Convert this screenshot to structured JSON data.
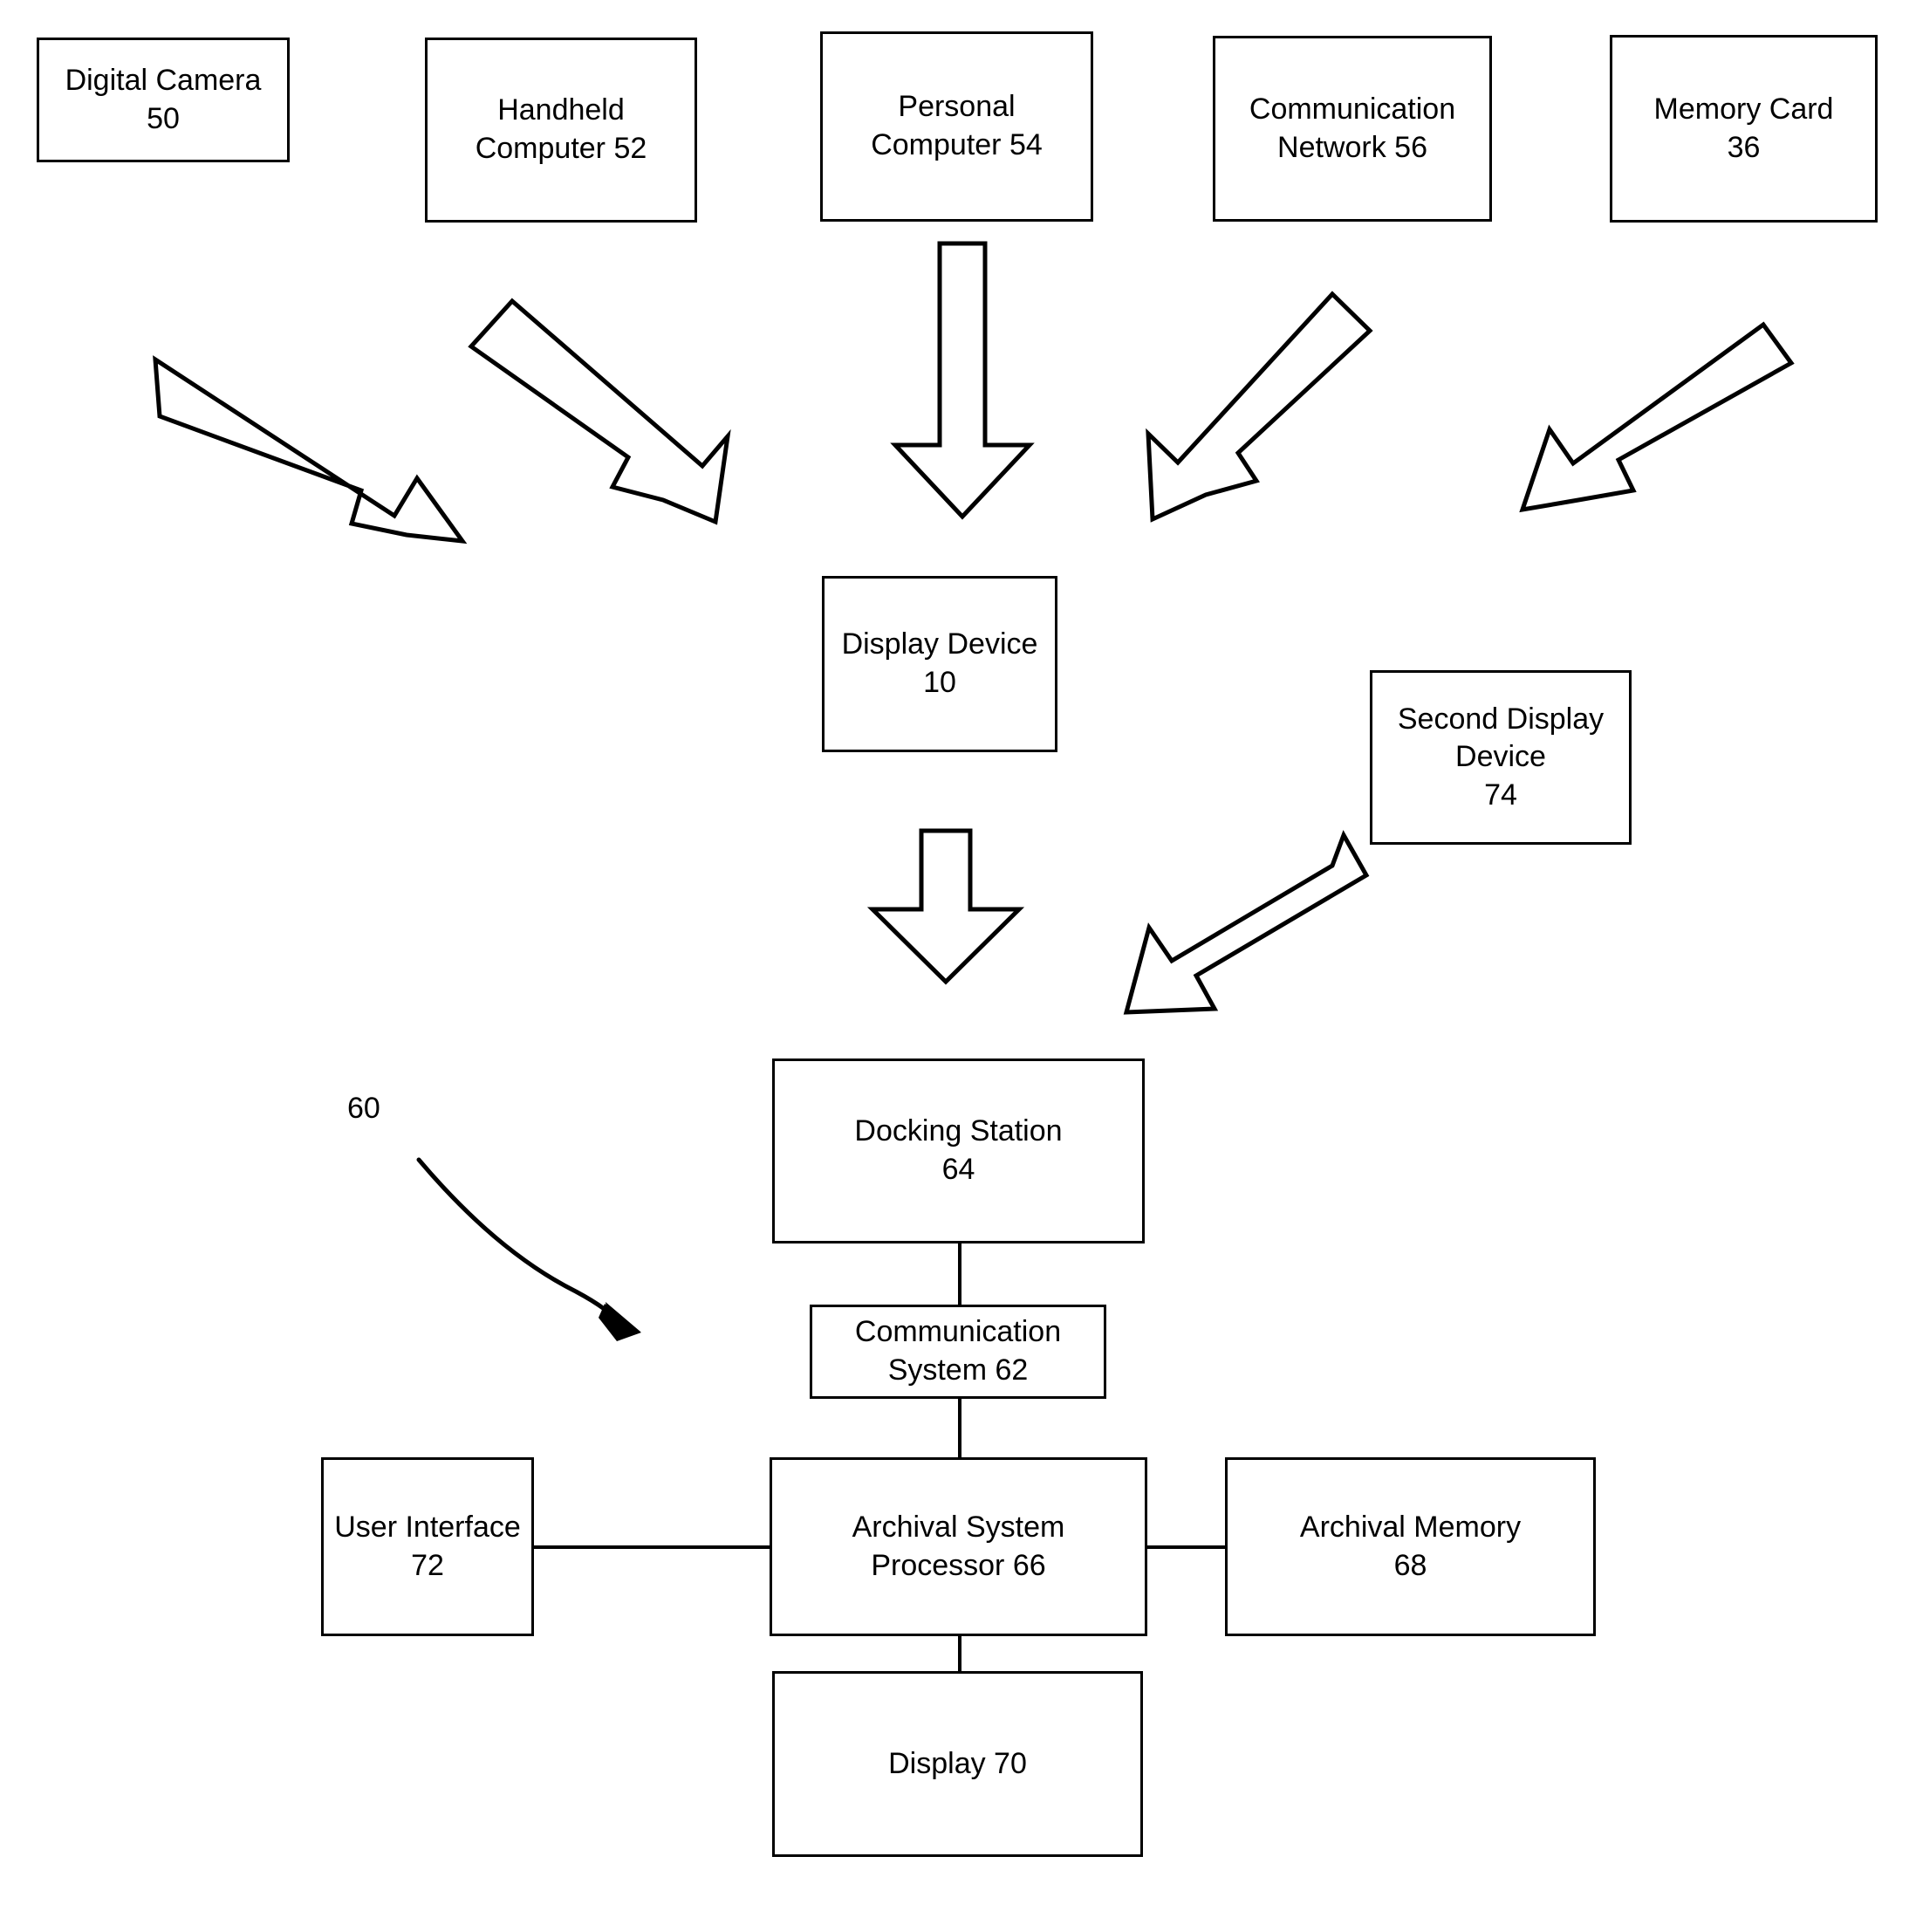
{
  "figure": {
    "type": "patent-block-diagram",
    "system_reference_label": "60",
    "nodes": [
      {
        "id": "digital-camera",
        "label": "Digital Camera\n50",
        "name": "Digital Camera",
        "ref": "50"
      },
      {
        "id": "handheld-computer",
        "label": "Handheld\nComputer 52",
        "name": "Handheld Computer",
        "ref": "52"
      },
      {
        "id": "personal-computer",
        "label": "Personal\nComputer 54",
        "name": "Personal Computer",
        "ref": "54"
      },
      {
        "id": "communication-network",
        "label": "Communication\nNetwork 56",
        "name": "Communication Network",
        "ref": "56"
      },
      {
        "id": "memory-card",
        "label": "Memory Card\n36",
        "name": "Memory Card",
        "ref": "36"
      },
      {
        "id": "display-device",
        "label": "Display Device\n10",
        "name": "Display Device",
        "ref": "10"
      },
      {
        "id": "second-display-device",
        "label": "Second Display\nDevice\n74",
        "name": "Second Display Device",
        "ref": "74"
      },
      {
        "id": "docking-station",
        "label": "Docking Station\n64",
        "name": "Docking Station",
        "ref": "64"
      },
      {
        "id": "communication-system",
        "label": "Communication\nSystem 62",
        "name": "Communication System",
        "ref": "62"
      },
      {
        "id": "user-interface",
        "label": "User Interface\n72",
        "name": "User Interface",
        "ref": "72"
      },
      {
        "id": "archival-system-processor",
        "label": "Archival System\nProcessor 66",
        "name": "Archival System Processor",
        "ref": "66"
      },
      {
        "id": "archival-memory",
        "label": "Archival Memory\n68",
        "name": "Archival Memory",
        "ref": "68"
      },
      {
        "id": "display-70",
        "label": "Display 70",
        "name": "Display",
        "ref": "70"
      }
    ],
    "connections": [
      {
        "from": "digital-camera",
        "to": "display-device",
        "style": "block-arrow-diagonal"
      },
      {
        "from": "handheld-computer",
        "to": "display-device",
        "style": "block-arrow-diagonal"
      },
      {
        "from": "personal-computer",
        "to": "display-device",
        "style": "block-arrow-vertical"
      },
      {
        "from": "communication-network",
        "to": "display-device",
        "style": "block-arrow-diagonal"
      },
      {
        "from": "memory-card",
        "to": "display-device",
        "style": "block-arrow-diagonal"
      },
      {
        "from": "display-device",
        "to": "docking-station",
        "style": "block-arrow-vertical"
      },
      {
        "from": "second-display-device",
        "to": "docking-station",
        "style": "block-arrow-diagonal"
      },
      {
        "from": "docking-station",
        "to": "communication-system",
        "style": "plain-line"
      },
      {
        "from": "communication-system",
        "to": "archival-system-processor",
        "style": "plain-line"
      },
      {
        "from": "user-interface",
        "to": "archival-system-processor",
        "style": "plain-line"
      },
      {
        "from": "archival-system-processor",
        "to": "archival-memory",
        "style": "plain-line"
      },
      {
        "from": "archival-system-processor",
        "to": "display-70",
        "style": "plain-line"
      }
    ],
    "colors": {
      "stroke": "#000000",
      "fill": "#ffffff",
      "text": "#000000"
    }
  }
}
